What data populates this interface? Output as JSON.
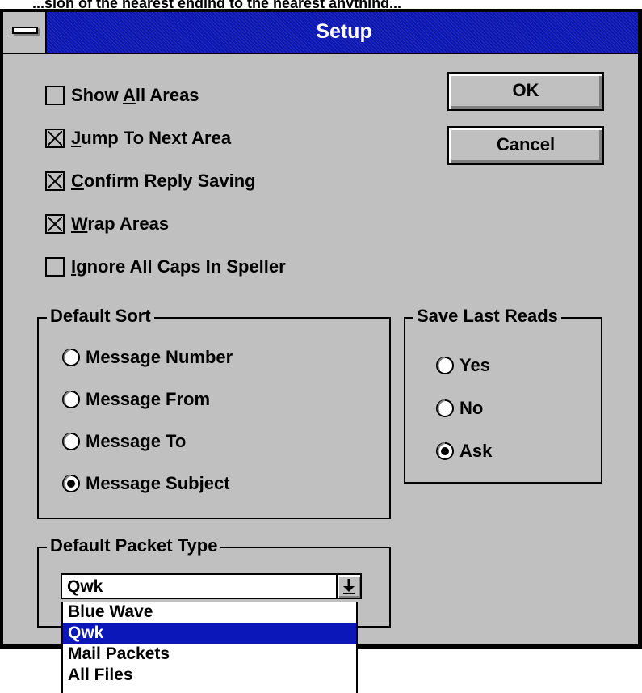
{
  "top_caption": "...sion of the nearest ending to the nearest anything...",
  "window": {
    "title": "Setup"
  },
  "checkboxes": [
    {
      "pre": "Show ",
      "accel": "A",
      "post": "ll Areas",
      "checked": false
    },
    {
      "pre": "",
      "accel": "J",
      "post": "ump To Next Area",
      "checked": true
    },
    {
      "pre": "",
      "accel": "C",
      "post": "onfirm Reply Saving",
      "checked": true
    },
    {
      "pre": "",
      "accel": "W",
      "post": "rap Areas",
      "checked": true
    },
    {
      "pre": "",
      "accel": "I",
      "post": "gnore All Caps In Speller",
      "checked": false
    }
  ],
  "buttons": {
    "ok": "OK",
    "cancel": "Cancel"
  },
  "default_sort": {
    "label": "Default Sort",
    "options": [
      "Message Number",
      "Message From",
      "Message To",
      "Message Subject"
    ],
    "selected": "Message Subject"
  },
  "save_last_reads": {
    "label": "Save Last Reads",
    "options": [
      "Yes",
      "No",
      "Ask"
    ],
    "selected": "Ask"
  },
  "default_packet_type": {
    "label": "Default Packet Type",
    "value": "Qwk",
    "options": [
      "Blue Wave",
      "Qwk",
      "Mail Packets",
      "All Files"
    ],
    "selected": "Qwk"
  },
  "colors": {
    "titlebar": "#0b17b9",
    "face": "#c0c0c0",
    "highlight": "#0b17b9"
  },
  "icons": {
    "system_menu": "system-menu-icon",
    "dropdown_arrow": "arrow-down-icon"
  }
}
